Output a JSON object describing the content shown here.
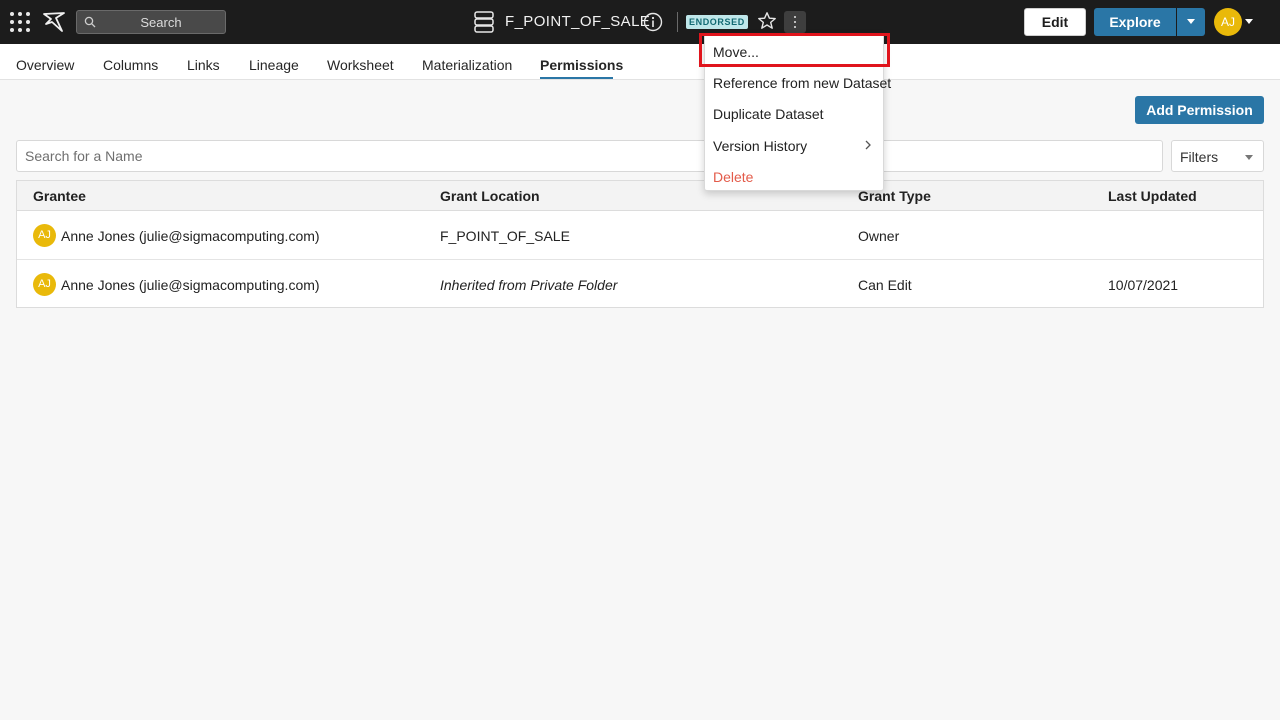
{
  "topbar": {
    "search_label": "Search",
    "doc_title": "F_POINT_OF_SALE",
    "badge": "ENDORSED",
    "edit_label": "Edit",
    "explore_label": "Explore",
    "avatar_initials": "AJ"
  },
  "tabs": [
    {
      "label": "Overview"
    },
    {
      "label": "Columns"
    },
    {
      "label": "Links"
    },
    {
      "label": "Lineage"
    },
    {
      "label": "Worksheet"
    },
    {
      "label": "Materialization"
    },
    {
      "label": "Permissions"
    }
  ],
  "active_tab": "Permissions",
  "main": {
    "add_permission_label": "Add Permission",
    "search_placeholder": "Search for a Name",
    "filters_label": "Filters"
  },
  "table": {
    "headers": [
      "Grantee",
      "Grant Location",
      "Grant Type",
      "Last Updated"
    ],
    "rows": [
      {
        "initials": "AJ",
        "grantee": "Anne Jones (julie@sigmacomputing.com)",
        "location": "F_POINT_OF_SALE",
        "type": "Owner",
        "updated": ""
      },
      {
        "initials": "AJ",
        "grantee": "Anne Jones (julie@sigmacomputing.com)",
        "location": "Inherited from Private Folder",
        "type": "Can Edit",
        "updated": "10/07/2021"
      }
    ]
  },
  "menu": {
    "items": [
      {
        "label": "Move..."
      },
      {
        "label": "Reference from new Dataset"
      },
      {
        "label": "Duplicate Dataset"
      },
      {
        "label": "Version History"
      },
      {
        "label": "Delete"
      }
    ]
  },
  "colors": {
    "topbar_bg": "#1c1c1c",
    "accent": "#2a76a6",
    "avatar": "#e9b90a",
    "badge_bg": "#bfe7ea",
    "danger": "#e35b4a",
    "highlight": "#e0141c"
  }
}
